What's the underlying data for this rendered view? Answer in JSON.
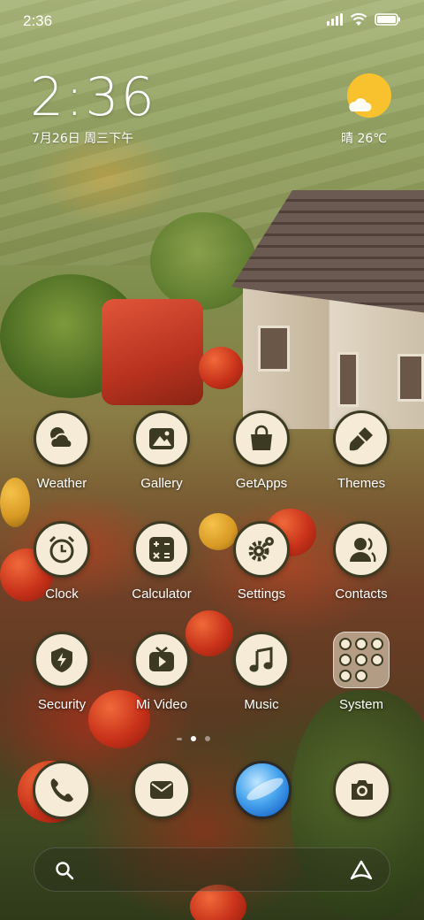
{
  "status_bar": {
    "time": "2:36",
    "icons": [
      "signal-icon",
      "wifi-icon",
      "battery-icon"
    ]
  },
  "clock_widget": {
    "time": "2:36",
    "date": "7月26日 周三下午"
  },
  "weather_widget": {
    "icon": "sun-cloud-icon",
    "text": "晴 26℃"
  },
  "apps": [
    {
      "label": "Weather",
      "icon": "weather-icon"
    },
    {
      "label": "Gallery",
      "icon": "gallery-icon"
    },
    {
      "label": "GetApps",
      "icon": "getapps-icon"
    },
    {
      "label": "Themes",
      "icon": "themes-icon"
    },
    {
      "label": "Clock",
      "icon": "clock-icon"
    },
    {
      "label": "Calculator",
      "icon": "calculator-icon"
    },
    {
      "label": "Settings",
      "icon": "settings-icon"
    },
    {
      "label": "Contacts",
      "icon": "contacts-icon"
    },
    {
      "label": "Security",
      "icon": "security-icon"
    },
    {
      "label": "Mi Video",
      "icon": "mi-video-icon"
    },
    {
      "label": "Music",
      "icon": "music-icon"
    },
    {
      "label": "System",
      "icon": "folder-icon"
    }
  ],
  "page_indicator": {
    "pages": 2,
    "current": 1
  },
  "dock": [
    {
      "icon": "phone-icon"
    },
    {
      "icon": "messages-icon"
    },
    {
      "icon": "browser-icon"
    },
    {
      "icon": "camera-icon"
    }
  ],
  "search_bar": {
    "icon": "search-icon",
    "assistant_icon": "assistant-icon"
  },
  "colors": {
    "icon_bg": "#f5ebd6",
    "icon_glyph": "#3c3a22",
    "sun": "#f7c22e"
  }
}
